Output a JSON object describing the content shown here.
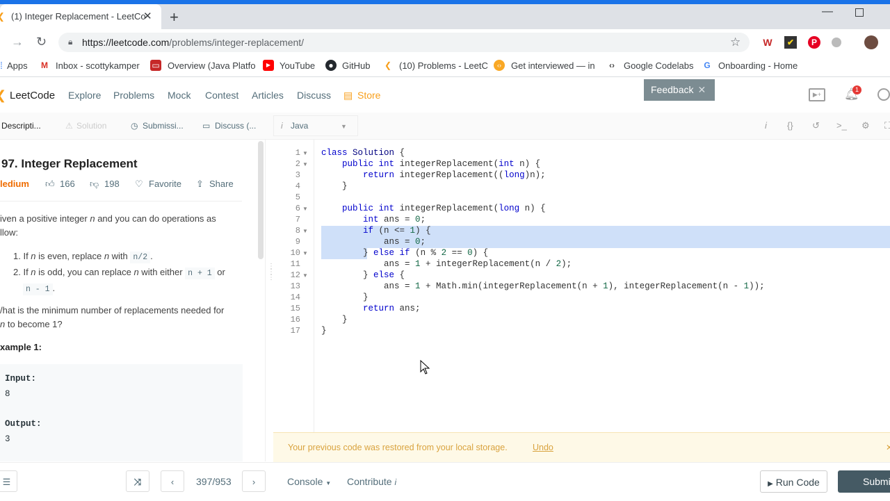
{
  "browser": {
    "tab_title": "(1) Integer Replacement - LeetCo",
    "tab_close": "✕",
    "new_tab": "+",
    "url_host": "https://leetcode.com",
    "url_path": "/problems/integer-replacement/",
    "bookmarks": [
      {
        "label": "Apps"
      },
      {
        "label": "Inbox - scottykamper"
      },
      {
        "label": "Overview (Java Platfo"
      },
      {
        "label": "YouTube"
      },
      {
        "label": "GitHub"
      },
      {
        "label": "(10) Problems - LeetC"
      },
      {
        "label": "Get interviewed — in"
      },
      {
        "label": "Google Codelabs"
      },
      {
        "label": "Onboarding - Home"
      }
    ],
    "extensions_colors": {
      "w": "#c62828",
      "check": "#5d4037",
      "pinterest": "#e60023"
    }
  },
  "leetcode_nav": {
    "logo": "LeetCode",
    "items": [
      "Explore",
      "Problems",
      "Mock",
      "Contest",
      "Articles",
      "Discuss"
    ],
    "store": "Store",
    "feedback": "Feedback",
    "notification_count": "1"
  },
  "panel_tabs": {
    "description": "Descripti...",
    "solution": "Solution",
    "submissions": "Submissi...",
    "discuss": "Discuss (...",
    "language": "Java"
  },
  "problem": {
    "title": "97. Integer Replacement",
    "difficulty": "ledium",
    "likes": "166",
    "dislikes": "198",
    "favorite": "Favorite",
    "share": "Share",
    "intro_a": "iven a positive integer ",
    "intro_n": "n",
    "intro_b": " and you can do operations as",
    "intro_c": "llow:",
    "rule1_a": "1. If ",
    "rule1_b": " is even, replace ",
    "rule1_c": " with ",
    "rule1_code": "n/2",
    "rule1_d": ".",
    "rule2_a": "2. If ",
    "rule2_b": " is odd, you can replace ",
    "rule2_c": " with either ",
    "rule2_code1": "n + 1",
    "rule2_d": " or",
    "rule2_code2": "n - 1",
    "rule2_e": ".",
    "question_a": "/hat is the minimum number of replacements needed for",
    "question_b": " to become 1?",
    "example_heading": "xample 1:",
    "input_label": "Input:",
    "input_value": "8",
    "output_label": "Output:",
    "output_value": "3"
  },
  "editor": {
    "line_numbers": [
      "1",
      "2",
      "3",
      "4",
      "5",
      "6",
      "7",
      "8",
      "9",
      "10",
      "11",
      "12",
      "13",
      "14",
      "15",
      "16",
      "17"
    ]
  },
  "notice": {
    "text": "Your previous code was restored from your local storage.",
    "undo": "Undo"
  },
  "bottom": {
    "pager": "397/953",
    "console": "Console",
    "contribute": "Contribute",
    "run_code": "Run Code",
    "submit": "Submit"
  }
}
